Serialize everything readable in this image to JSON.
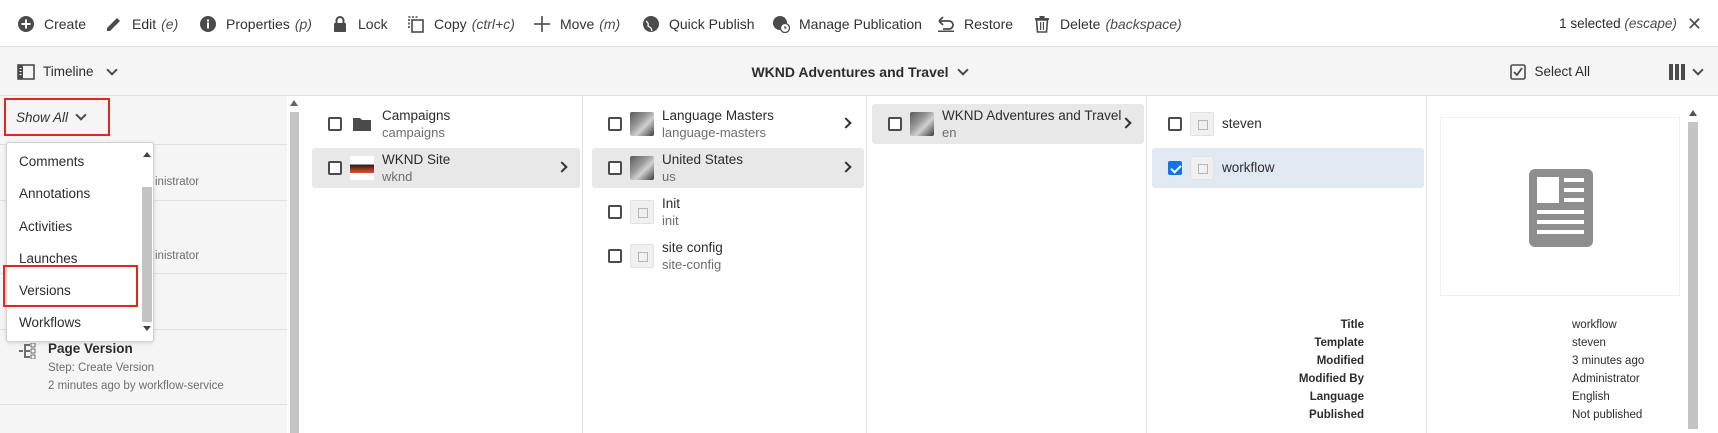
{
  "toolbar": {
    "create": "Create",
    "edit": "Edit",
    "edit_shortcut": "(e)",
    "properties": "Properties",
    "properties_shortcut": "(p)",
    "lock": "Lock",
    "copy": "Copy",
    "copy_shortcut": "(ctrl+c)",
    "move": "Move",
    "move_shortcut": "(m)",
    "quick_publish": "Quick Publish",
    "manage_publication": "Manage Publication",
    "restore": "Restore",
    "delete": "Delete",
    "delete_shortcut": "(backspace)",
    "selected_count": "1 selected",
    "selected_escape": "(escape)"
  },
  "secondary_bar": {
    "rail_label": "Timeline",
    "breadcrumb_title": "WKND Adventures and Travel",
    "select_all": "Select All"
  },
  "timeline": {
    "filter_label": "Show All",
    "entry1_meta": "inistrator",
    "entry2_meta": "inistrator",
    "page_version_title": "Page Version",
    "page_version_step": "Step: Create Version",
    "page_version_time": "2 minutes ago by workflow-service"
  },
  "dropdown": {
    "items": [
      "Comments",
      "Annotations",
      "Activities",
      "Launches",
      "Versions",
      "Workflows"
    ],
    "highlighted": "Versions"
  },
  "columns": {
    "col1": [
      {
        "title": "Campaigns",
        "name": "campaigns",
        "has_children": false,
        "selected": false
      },
      {
        "title": "WKND Site",
        "name": "wknd",
        "has_children": true,
        "selected": true
      }
    ],
    "col2": [
      {
        "title": "Language Masters",
        "name": "language-masters",
        "has_children": true,
        "selected": false
      },
      {
        "title": "United States",
        "name": "us",
        "has_children": true,
        "selected": true
      },
      {
        "title": "Init",
        "name": "init",
        "has_children": false,
        "selected": false
      },
      {
        "title": "site config",
        "name": "site-config",
        "has_children": false,
        "selected": false
      }
    ],
    "col3": [
      {
        "title": "WKND Adventures and Travel",
        "name": "en",
        "has_children": true,
        "selected": true
      }
    ],
    "col4": [
      {
        "title": "steven",
        "checked": false
      },
      {
        "title": "workflow",
        "checked": true
      }
    ]
  },
  "preview": {
    "meta": [
      {
        "label": "Title",
        "value": "workflow"
      },
      {
        "label": "Template",
        "value": "steven"
      },
      {
        "label": "Modified",
        "value": "3 minutes ago"
      },
      {
        "label": "Modified By",
        "value": "Administrator"
      },
      {
        "label": "Language",
        "value": "English"
      },
      {
        "label": "Published",
        "value": "Not published"
      }
    ]
  },
  "colors": {
    "accent": "#1473e6",
    "highlight_border": "#e0291d"
  }
}
